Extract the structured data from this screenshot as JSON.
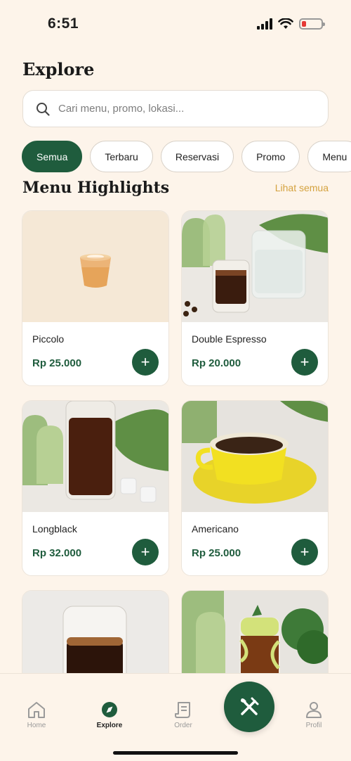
{
  "status": {
    "time": "6:51"
  },
  "header": {
    "title": "Explore"
  },
  "search": {
    "placeholder": "Cari menu, promo, lokasi..."
  },
  "filters": [
    "Semua",
    "Terbaru",
    "Reservasi",
    "Promo",
    "Menu"
  ],
  "highlights": {
    "title": "Menu Highlights",
    "see_all": "Lihat semua",
    "items": [
      {
        "name": "Piccolo",
        "price": "Rp 25.000"
      },
      {
        "name": "Double Espresso",
        "price": "Rp 20.000"
      },
      {
        "name": "Longblack",
        "price": "Rp 32.000"
      },
      {
        "name": "Americano",
        "price": "Rp 25.000"
      }
    ]
  },
  "nav": {
    "home": "Home",
    "explore": "Explore",
    "order": "Order",
    "profile": "Profil"
  },
  "colors": {
    "primary": "#1f5c3d",
    "accent": "#d4a23f",
    "background": "#fdf4ea"
  }
}
